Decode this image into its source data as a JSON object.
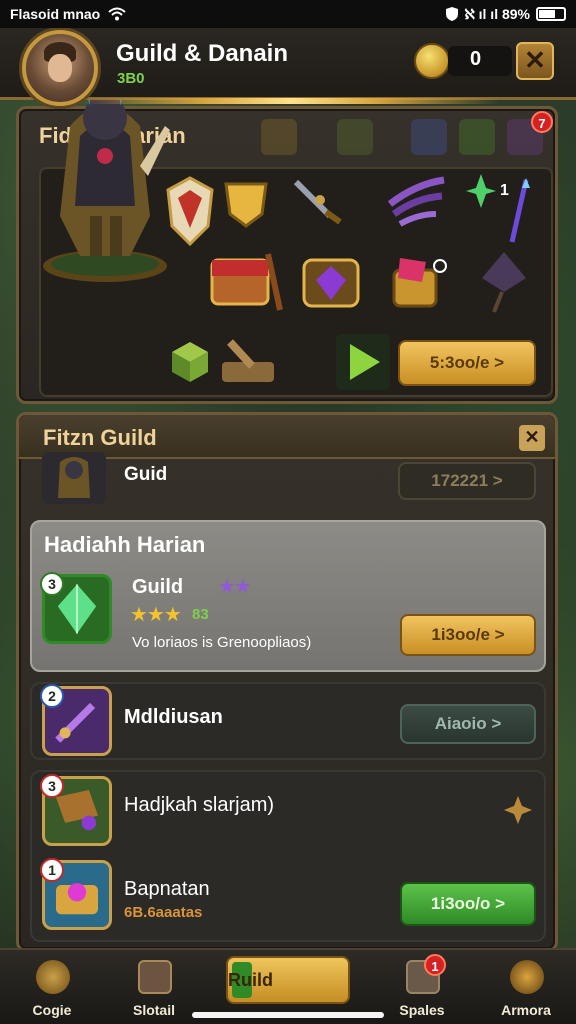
{
  "status_bar": {
    "carrier": "Flasoid mnao",
    "right_text": "ℵ ıl ıl 89%"
  },
  "header": {
    "title": "Guild & Danain",
    "subtitle": "3B0",
    "coin_count": "0",
    "close_symbol": "✕"
  },
  "top_panel": {
    "title": "Fidthal Harian",
    "badge_count": "7",
    "side_counter": "1",
    "claim_button": "5:3oo/e >"
  },
  "guild_panel": {
    "title": "Fitzn Guild",
    "close_symbol": "✕",
    "row_name": "Guid",
    "row_button": "172221 >"
  },
  "cards": [
    {
      "title": "Hadiahh Harian",
      "subtitle": "Guild",
      "level": "3",
      "stars_text": "★★★",
      "stars_suffix": "83",
      "purple_stars": "★★",
      "desc": "Vo loriaos is Grenoopliaos)",
      "button": "1i3oo/e >"
    },
    {
      "title": "Mdldiusan",
      "level": "2",
      "button": "Aiaoio >"
    },
    {
      "title": "Hadjkah slarjam)",
      "level": "3"
    },
    {
      "title": "Bapnatan",
      "level": "1",
      "sub": "6B.6aaatas",
      "button": "1i3oo/o >"
    }
  ],
  "bottom_nav": [
    {
      "label": "Cogie"
    },
    {
      "label": "Slotail"
    },
    {
      "label": "Ruild"
    },
    {
      "label": "Spales",
      "badge": "1"
    },
    {
      "label": "Armora"
    }
  ],
  "colors": {
    "accent_gold": "#e0b65a",
    "accent_green": "#5cc34a",
    "panel": "#2a2621"
  }
}
